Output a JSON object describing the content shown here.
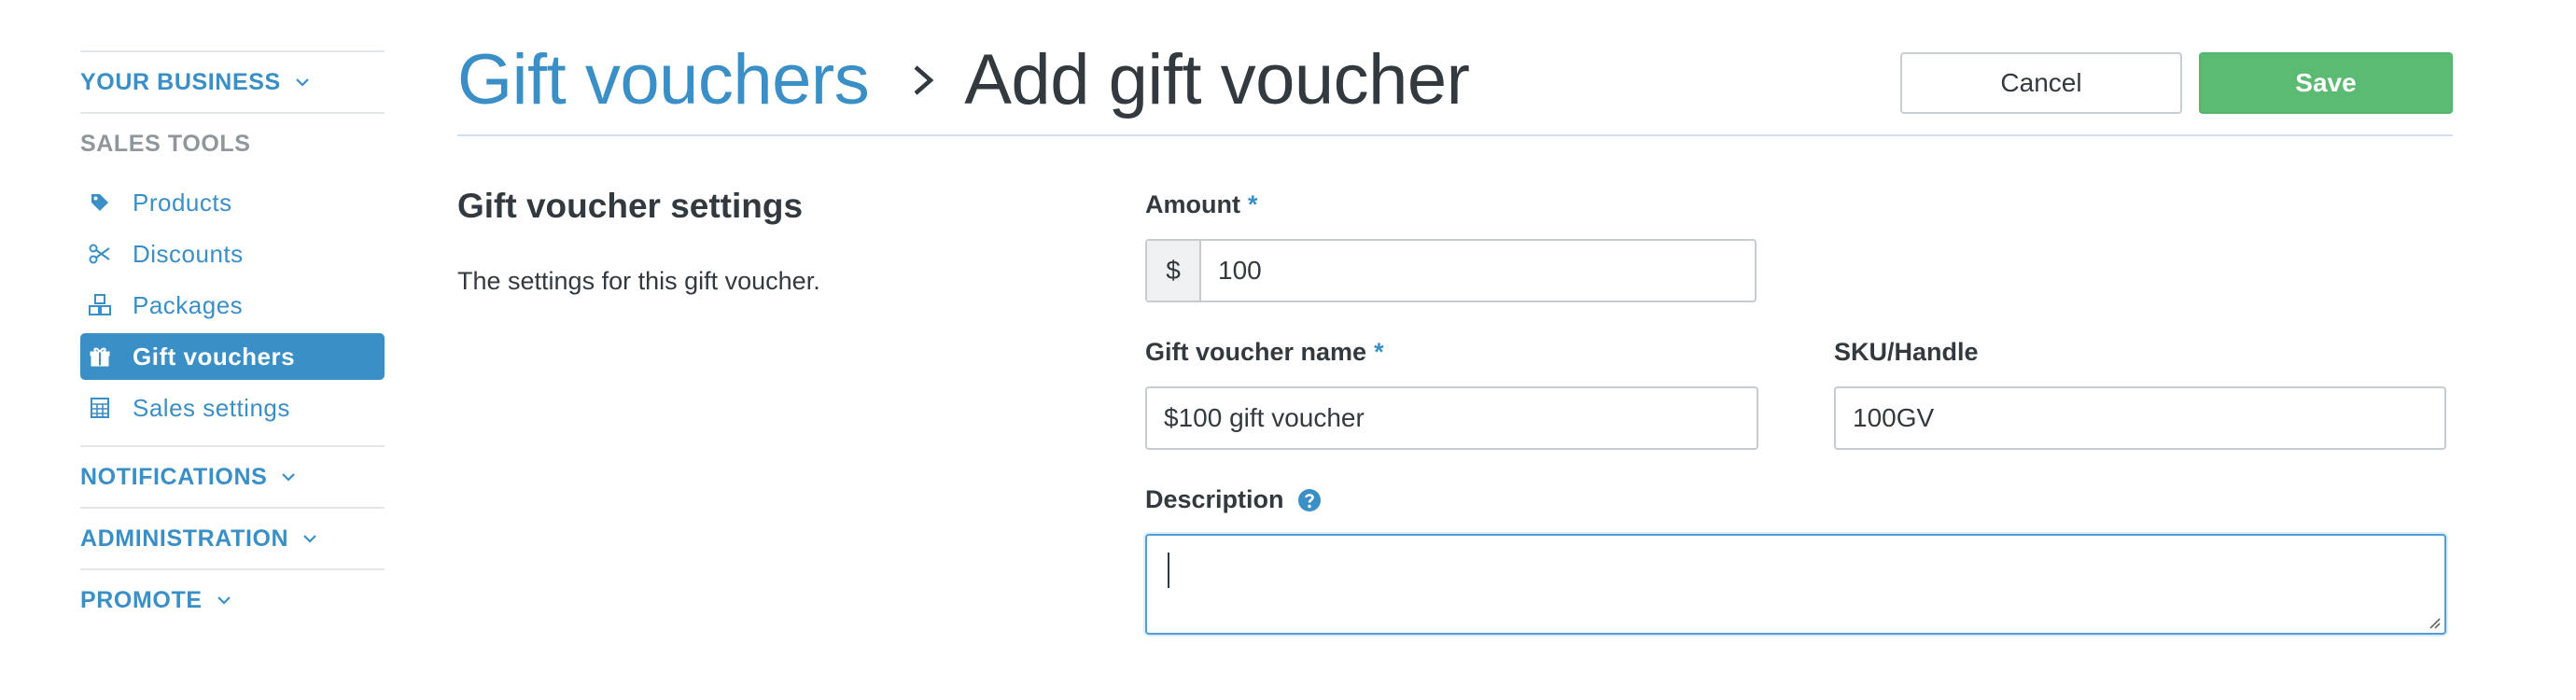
{
  "sidebar": {
    "your_business": "YOUR BUSINESS",
    "sales_tools": "SALES TOOLS",
    "items": [
      {
        "label": "Products",
        "icon": "tag-icon"
      },
      {
        "label": "Discounts",
        "icon": "scissors-icon"
      },
      {
        "label": "Packages",
        "icon": "boxes-icon"
      },
      {
        "label": "Gift vouchers",
        "icon": "gift-icon",
        "active": true
      },
      {
        "label": "Sales settings",
        "icon": "calculator-icon"
      }
    ],
    "notifications": "NOTIFICATIONS",
    "administration": "ADMINISTRATION",
    "promote": "PROMOTE"
  },
  "header": {
    "breadcrumb_parent": "Gift vouchers",
    "breadcrumb_current": "Add gift voucher",
    "cancel_label": "Cancel",
    "save_label": "Save"
  },
  "section": {
    "title": "Gift voucher settings",
    "description": "The settings for this gift voucher."
  },
  "form": {
    "amount": {
      "label": "Amount",
      "required": "*",
      "prefix": "$",
      "value": "100"
    },
    "name": {
      "label": "Gift voucher name",
      "required": "*",
      "value": "$100 gift voucher"
    },
    "sku": {
      "label": "SKU/Handle",
      "value": "100GV"
    },
    "description": {
      "label": "Description",
      "value": ""
    }
  },
  "colors": {
    "accent": "#3a8fc7",
    "save": "#5cbb73",
    "text": "#333a3f",
    "muted": "#8f979d"
  }
}
